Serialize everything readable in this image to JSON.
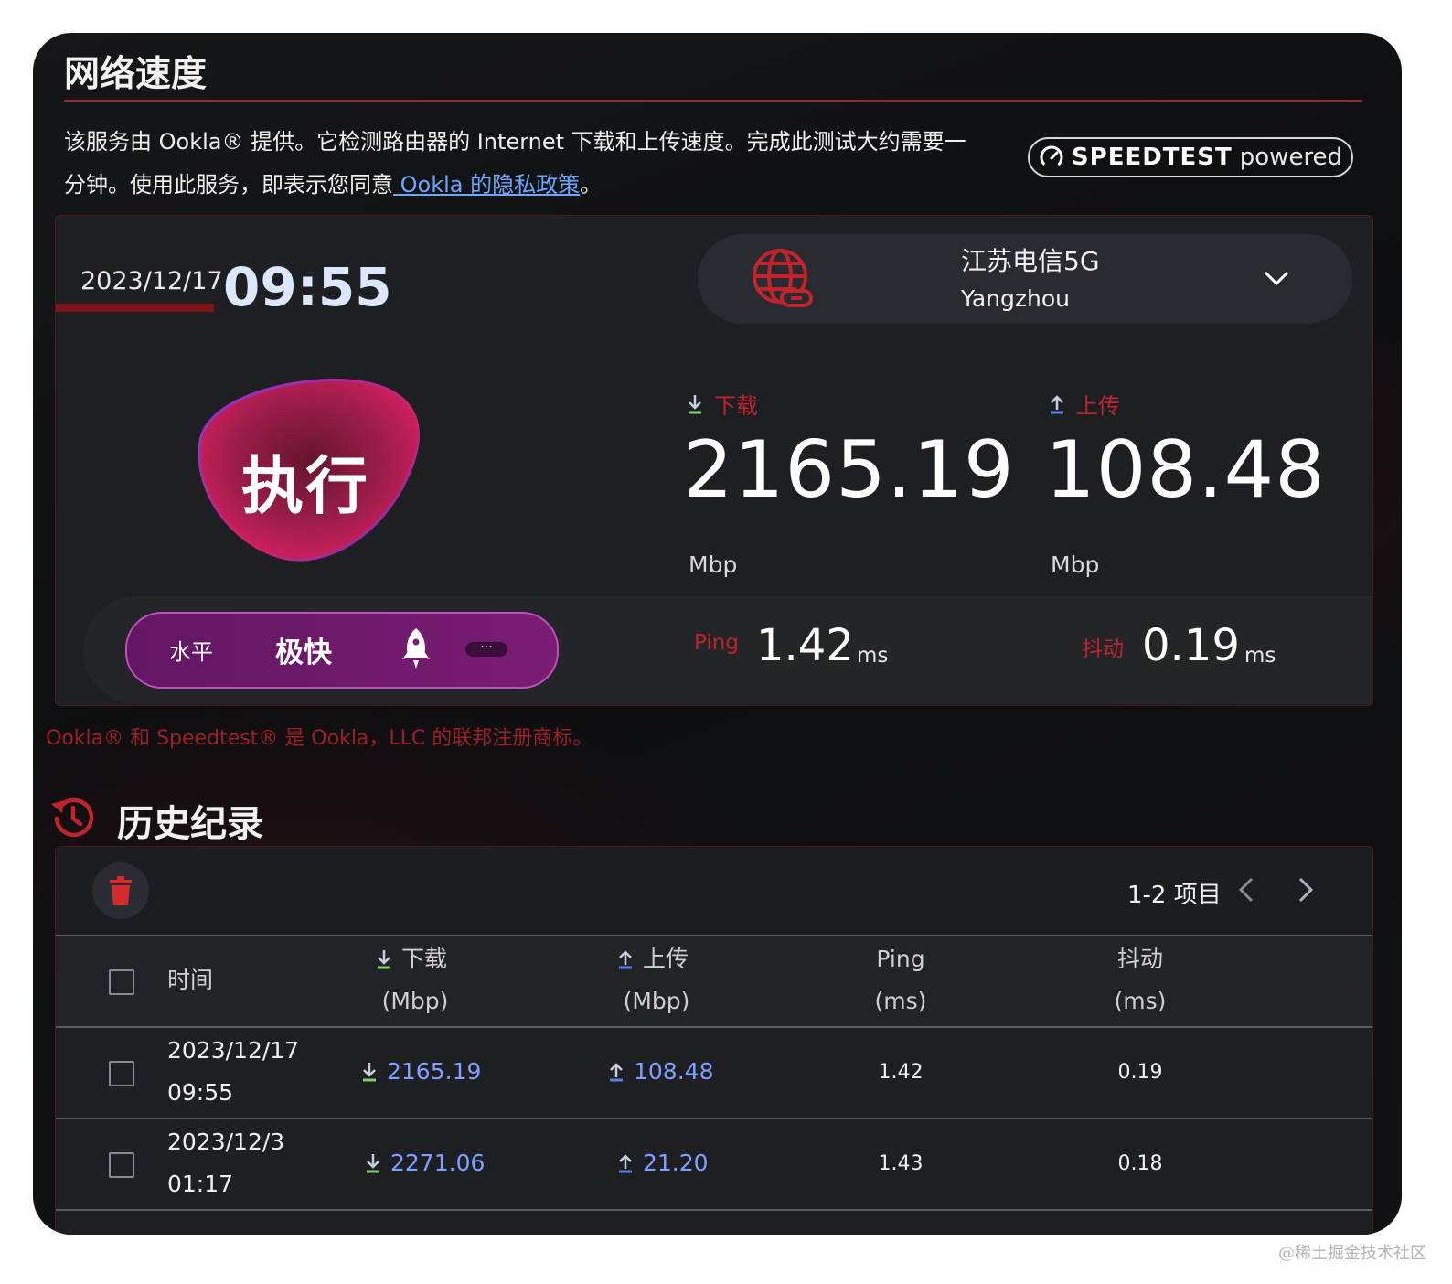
{
  "panel": {
    "title": "网络速度",
    "intro_text": "该服务由 Ookla® 提供。它检测路由器的 Internet 下载和上传速度。完成此测试大约需要一分钟。使用此服务，即表示您同意",
    "privacy_link": " Ookla 的隐私政策",
    "intro_end": "。",
    "badge_brand": "SPEEDTEST",
    "badge_suffix": "powered"
  },
  "test": {
    "date": "2023/12/17",
    "time": "09:55",
    "server_name": "江苏电信5G",
    "server_city": "Yangzhou",
    "run_label": "执行",
    "download_label": "下载",
    "download_value": "2165.19",
    "download_unit": "Mbp",
    "upload_label": "上传",
    "upload_value": "108.48",
    "upload_unit": "Mbp",
    "level_label": "水平",
    "level_value": "极快",
    "more_label": "···",
    "ping_label": "Ping",
    "ping_value": "1.42",
    "ping_unit": "ms",
    "jitter_label": "抖动",
    "jitter_value": "0.19",
    "jitter_unit": "ms"
  },
  "trademark": "Ookla® 和 Speedtest® 是 Ookla，LLC 的联邦注册商标。",
  "history": {
    "title": "历史纪录",
    "pager_text": "1-2 项目",
    "columns": {
      "time": "时间",
      "download": "下载",
      "download_unit": "(Mbp)",
      "upload": "上传",
      "upload_unit": "(Mbp)",
      "ping": "Ping",
      "ping_unit": "(ms)",
      "jitter": "抖动",
      "jitter_unit": "(ms)"
    },
    "rows": [
      {
        "date": "2023/12/17",
        "time": "09:55",
        "download": "2165.19",
        "upload": "108.48",
        "ping": "1.42",
        "jitter": "0.19"
      },
      {
        "date": "2023/12/3",
        "time": "01:17",
        "download": "2271.06",
        "upload": "21.20",
        "ping": "1.43",
        "jitter": "0.18"
      }
    ]
  },
  "watermark": "@稀土掘金技术社区",
  "colors": {
    "accent_red": "#c0242c",
    "link_blue": "#6ea6ff",
    "rate_blue": "#7fa0ff",
    "level_purple": "#7a1d73"
  },
  "icons": {
    "server": "globe-link-icon",
    "server_menu": "chevron-down-icon",
    "download": "arrow-down-icon",
    "upload": "arrow-up-icon",
    "level": "rocket-icon",
    "history": "history-clock-icon",
    "delete": "trash-icon",
    "pager_prev": "chevron-left-icon",
    "pager_next": "chevron-right-icon"
  }
}
